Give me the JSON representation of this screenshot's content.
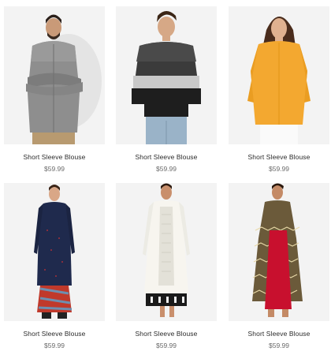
{
  "products": [
    {
      "image_icon": "man-grey-shirt-photo",
      "name": "Short Sleeve Blouse",
      "price": "$59.99"
    },
    {
      "image_icon": "man-striped-sweater-photo",
      "name": "Short Sleeve Blouse",
      "price": "$59.99"
    },
    {
      "image_icon": "woman-yellow-top-photo",
      "name": "Short Sleeve Blouse",
      "price": "$59.99"
    },
    {
      "image_icon": "woman-navy-kurta-photo",
      "name": "Short Sleeve Blouse",
      "price": "$59.99"
    },
    {
      "image_icon": "woman-white-kurta-photo",
      "name": "Short Sleeve Blouse",
      "price": "$59.99"
    },
    {
      "image_icon": "woman-printed-kurta-photo",
      "name": "Short Sleeve Blouse",
      "price": "$59.99"
    }
  ],
  "colors": {
    "card_background": "#f3f3f3",
    "title_text": "#2b2b2b",
    "price_text": "#6a6a6a"
  }
}
